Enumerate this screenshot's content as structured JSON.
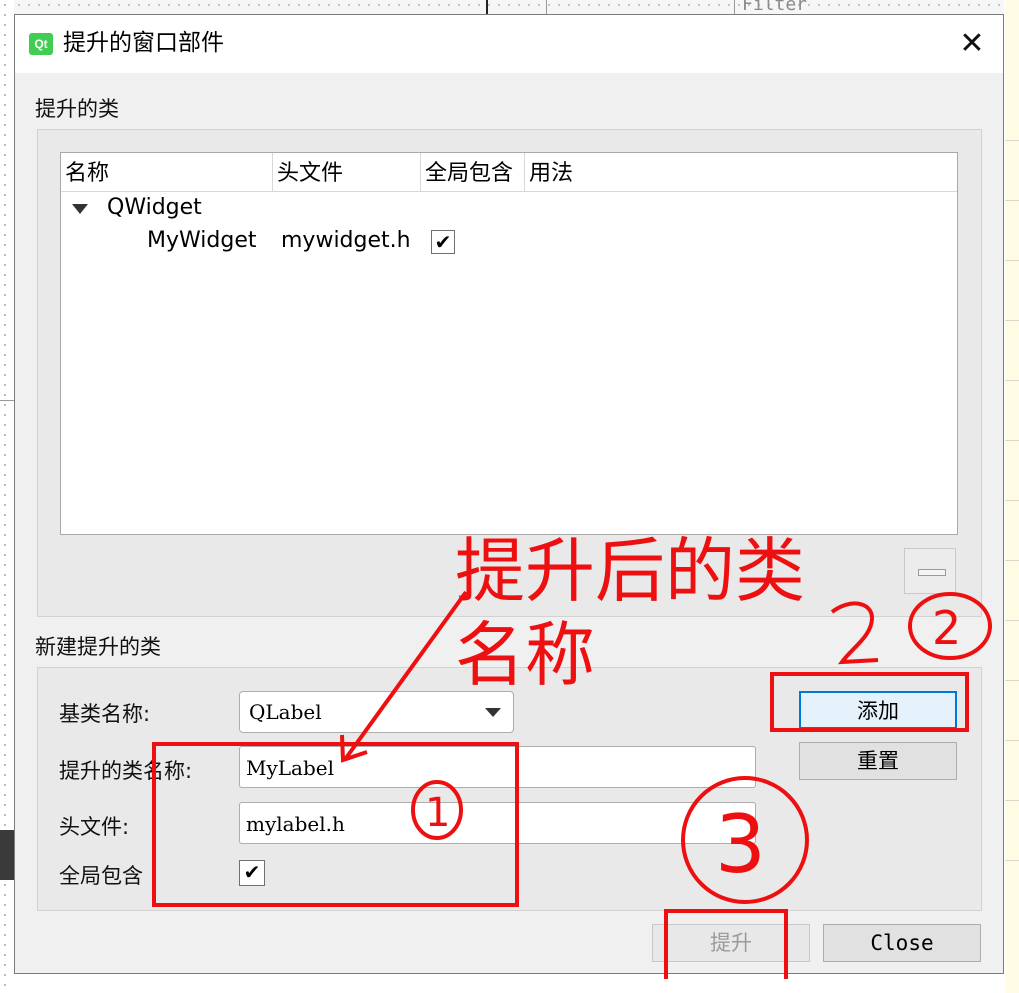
{
  "background": {
    "filter_text": "Filter"
  },
  "dialog": {
    "title": "提升的窗口部件",
    "icon_text": "Qt",
    "close_symbol": "✕"
  },
  "promoted_section": {
    "label": "提升的类",
    "columns": [
      "名称",
      "头文件",
      "全局包含",
      "用法"
    ],
    "tree": {
      "parent": "QWidget",
      "children": [
        {
          "name": "MyWidget",
          "header": "mywidget.h",
          "global_include": true
        }
      ]
    }
  },
  "new_section": {
    "label": "新建提升的类",
    "base_class_label": "基类名称:",
    "base_class_value": "QLabel",
    "promoted_name_label": "提升的类名称:",
    "promoted_name_value": "MyLabel",
    "header_label": "头文件:",
    "header_value": "mylabel.h",
    "global_include_label": "全局包含",
    "global_include_checked": true,
    "check_mark": "✔"
  },
  "buttons": {
    "add": "添加",
    "reset": "重置",
    "promote": "提升",
    "close": "Close"
  },
  "annotations": {
    "text_line1": "提升后的类",
    "text_line2": "名称",
    "circled_1": "1",
    "circled_2": "2",
    "circled_3": "3",
    "color": "#ee1010"
  }
}
